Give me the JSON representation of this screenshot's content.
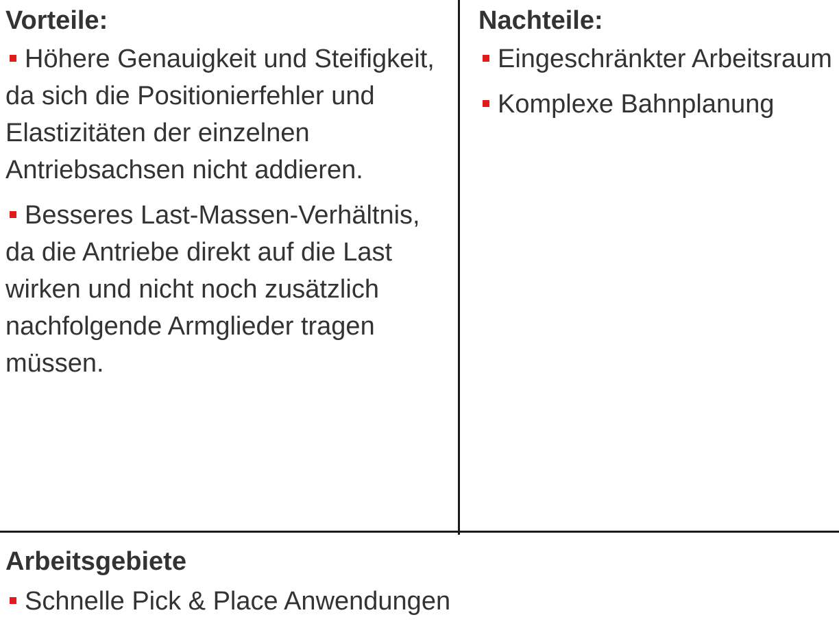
{
  "advantages": {
    "heading": "Vorteile:",
    "items": [
      "Höhere Genauigkeit und Steifigkeit, da sich die Positionierfehler und Elastizitäten der einzelnen Antriebsachsen nicht addieren.",
      "Besseres Last-Massen-Verhältnis, da die Antriebe direkt auf die Last wirken und nicht noch zusätzlich nachfolgende Armglieder tragen müssen."
    ]
  },
  "disadvantages": {
    "heading": "Nachteile:",
    "items": [
      "Eingeschränkter Arbeitsraum",
      "Komplexe Bahnplanung"
    ]
  },
  "application_areas": {
    "heading": "Arbeitsgebiete",
    "items": [
      "Schnelle Pick & Place Anwendungen"
    ]
  },
  "colors": {
    "bullet": "#e21a1a",
    "text": "#333333",
    "divider": "#1a1a1a"
  },
  "icons": {
    "bullet": "square-bullet-icon"
  }
}
